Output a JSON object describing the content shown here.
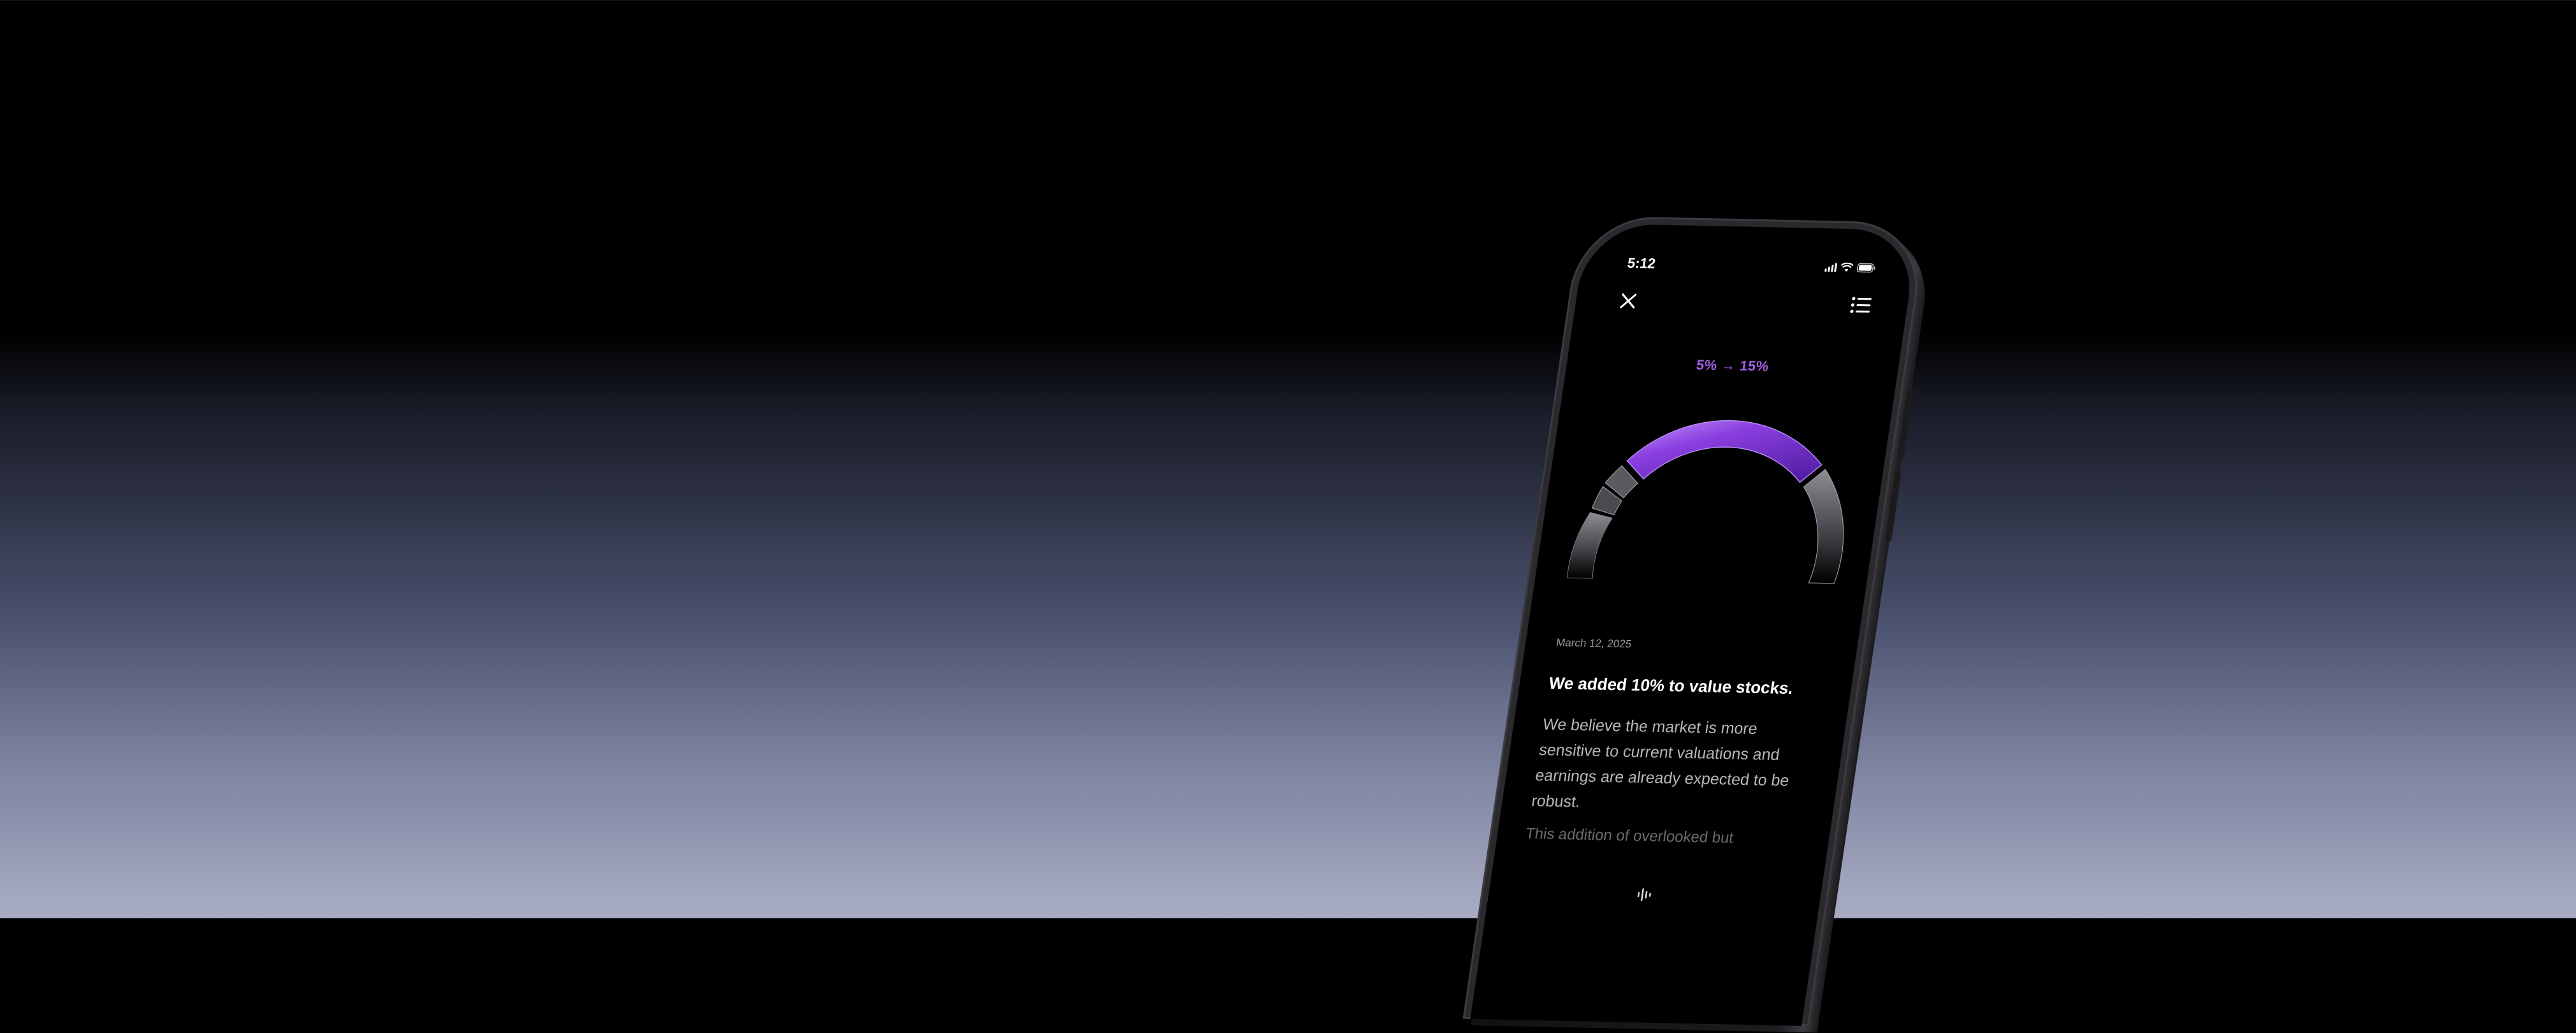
{
  "status_bar": {
    "time": "5:12"
  },
  "header": {
    "close_icon": "close-icon",
    "menu_icon": "list-icon"
  },
  "allocation": {
    "label": "5% → 15%",
    "from_percent": 5,
    "to_percent": 15
  },
  "colors": {
    "accent": "#a45ee8",
    "ring_gray": "#4a4a50",
    "background_top": "#000000",
    "background_bottom": "#a9adc4"
  },
  "update": {
    "date": "March 12, 2025",
    "headline": "We added 10% to value stocks.",
    "body": "We believe the market is more sensitive to current valuations and earnings are already expected to be robust.",
    "body_continued": "This addition of overlooked but"
  },
  "footer": {
    "audio_icon": "audio-waveform-icon"
  }
}
